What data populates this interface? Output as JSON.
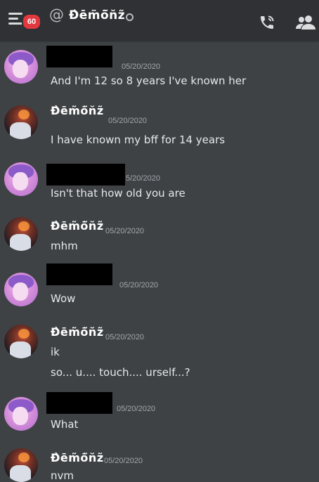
{
  "header": {
    "unread_count": "60",
    "at_symbol": "@",
    "channel_name": "Ɖ̀ēm̃ō̃n̆z̃"
  },
  "messages": [
    {
      "author": "",
      "timestamp": "05/20/2020",
      "lines": [
        "And I'm 12 so 8 years I've known her"
      ]
    },
    {
      "author": "Ɖ̀ēm̃ō̃n̆z̃",
      "timestamp": "05/20/2020",
      "lines": [
        "I have known my bff for 14 years"
      ]
    },
    {
      "author": "",
      "timestamp": "5/20/2020",
      "lines": [
        "Isn't that how old you are"
      ]
    },
    {
      "author": "Ɖ̀ēm̃ō̃n̆z̃",
      "timestamp": "05/20/2020",
      "lines": [
        "mhm"
      ]
    },
    {
      "author": "",
      "timestamp": "05/20/2020",
      "lines": [
        "Wow"
      ]
    },
    {
      "author": "Ɖ̀ēm̃ō̃n̆z̃",
      "timestamp": "05/20/2020",
      "lines": [
        "ik",
        "so... u.... touch.... urself...?"
      ]
    },
    {
      "author": "",
      "timestamp": "05/20/2020",
      "lines": [
        "What"
      ]
    },
    {
      "author": "Ɖ̀ēm̃ō̃n̆z̃",
      "timestamp": "05/20/2020",
      "lines": [
        "nvm"
      ]
    }
  ]
}
